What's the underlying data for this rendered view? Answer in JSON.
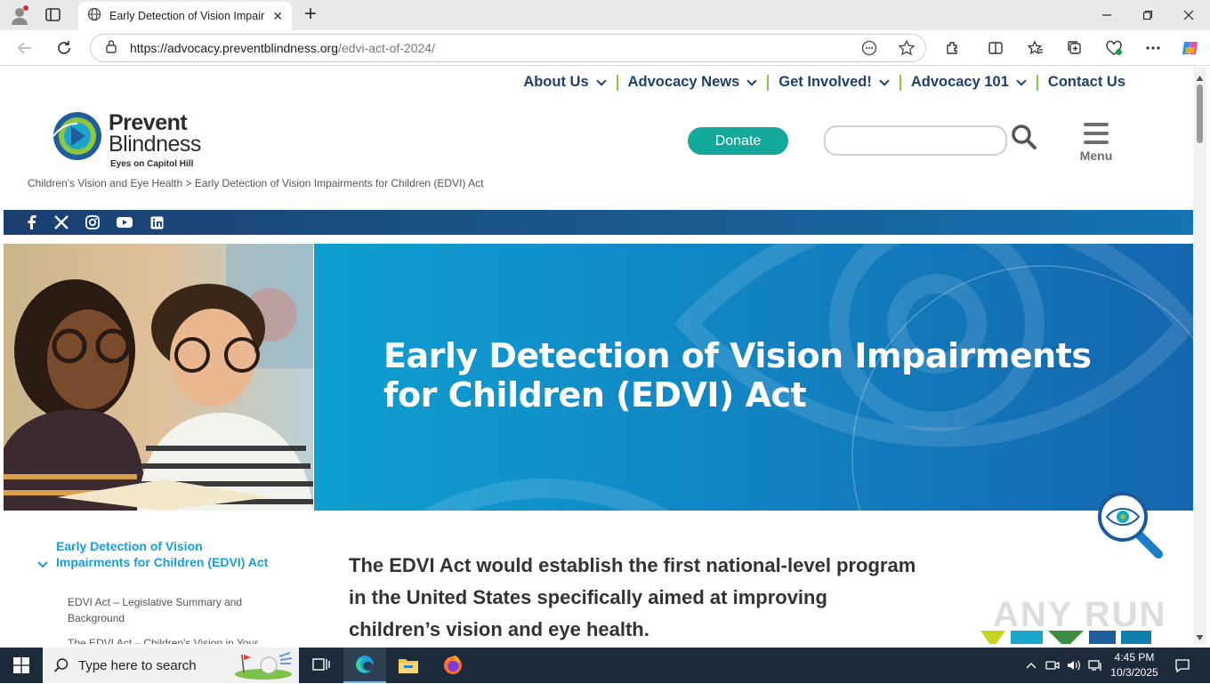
{
  "browser": {
    "tab_title": "Early Detection of Vision Impairm",
    "url_host": "https://advocacy.preventblindness.org",
    "url_path": "/edvi-act-of-2024/",
    "new_tab_glyph": "+",
    "close_tab_glyph": "✕"
  },
  "site": {
    "logo": {
      "name_line1": "Prevent",
      "name_line2": "Blindness",
      "tagline": "Eyes on Capitol Hill"
    },
    "nav": [
      {
        "label": "About Us"
      },
      {
        "label": "Advocacy News"
      },
      {
        "label": "Get Involved!"
      },
      {
        "label": "Advocacy 101"
      },
      {
        "label": "Contact Us"
      }
    ],
    "donate_label": "Donate",
    "search_placeholder": "",
    "menu_label": "Menu",
    "breadcrumb": {
      "parent": "Children's Vision and Eye Health",
      "separator": " > ",
      "current": "Early Detection of Vision Impairments for Children (EDVI) Act"
    },
    "social_icons": [
      "facebook-icon",
      "x-icon",
      "instagram-icon",
      "youtube-icon",
      "linkedin-icon"
    ],
    "hero_title": "Early Detection of Vision Impairments for Children (EDVI) Act",
    "sidebar": {
      "main_item": "Early Detection of Vision Impairments for Children (EDVI) Act",
      "sub_items": [
        "EDVI Act – Legislative Summary and Background",
        "The EDVI Act – Children's Vision in Your"
      ]
    },
    "lead_text": "The EDVI Act would establish the first national-level program in the United States specifically aimed at improving children’s vision and eye health."
  },
  "watermark": "ANY RUN",
  "taskbar": {
    "search_placeholder": "Type here to search",
    "time": "4:45 PM",
    "date": "10/3/2025"
  },
  "colors": {
    "nav_text": "#1f3e6a",
    "nav_separator": "#8dc63f",
    "donate": "#14a89c",
    "sidebar_link": "#1a9cd8",
    "banner_start": "#0e9fd0",
    "banner_end": "#1466ae"
  }
}
